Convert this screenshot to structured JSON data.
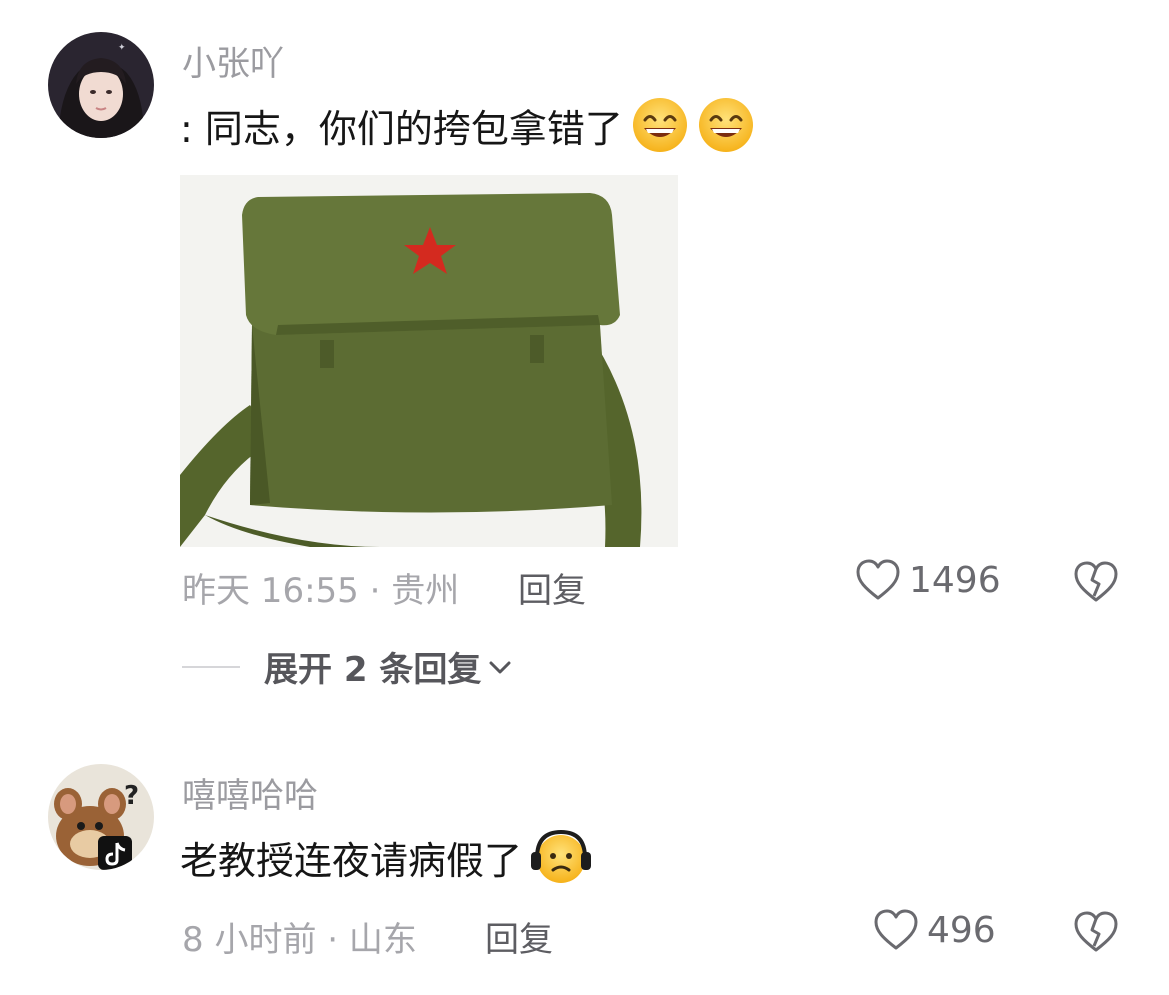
{
  "comments": [
    {
      "username": "小张吖",
      "text": ": 同志，你们的挎包拿错了",
      "time_location": "昨天 16:55 · 贵州",
      "reply_label": "回复",
      "likes": "1496",
      "expand_label": "展开 2 条回复",
      "emojis": [
        "grinning-face",
        "grinning-face"
      ]
    },
    {
      "username": "嘻嘻哈哈",
      "text": "老教授连夜请病假了",
      "time_location": "8 小时前 · 山东",
      "reply_label": "回复",
      "likes": "496",
      "emojis": [
        "headphone-face"
      ]
    }
  ],
  "colors": {
    "username": "#9b9ba0",
    "meta": "#a6a6ab",
    "bag_green": "#5b6b32",
    "star_red": "#d42a1f"
  },
  "icons": [
    "heart-outline-icon",
    "broken-heart-icon",
    "chevron-down-icon"
  ]
}
